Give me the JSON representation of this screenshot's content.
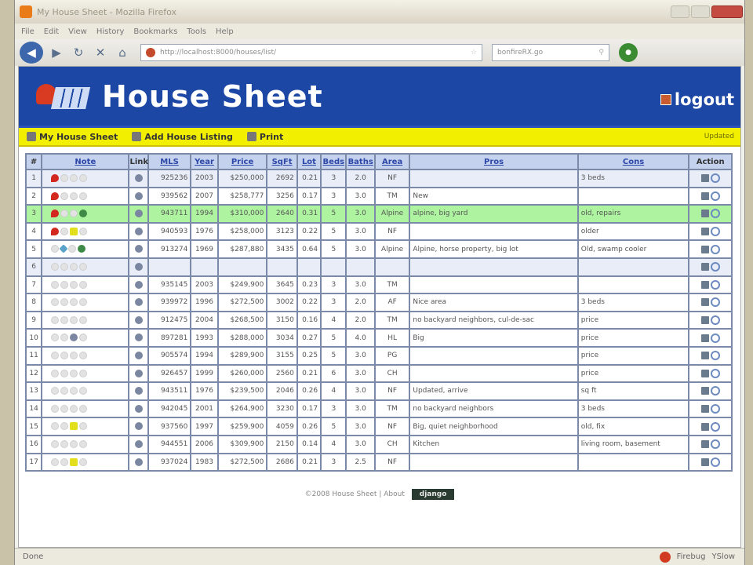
{
  "window": {
    "title": "My House Sheet - Mozilla Firefox"
  },
  "menu": [
    "File",
    "Edit",
    "View",
    "History",
    "Bookmarks",
    "Tools",
    "Help"
  ],
  "nav": {
    "url": "http://localhost:8000/houses/list/",
    "search": "bonfireRX.go"
  },
  "site": {
    "title": "House Sheet",
    "logout": "logout"
  },
  "toolbar": {
    "my_sheet": "My House Sheet",
    "add_listing": "Add House Listing",
    "print": "Print",
    "right": "Updated"
  },
  "table": {
    "headers": [
      "#",
      "Note",
      "Link",
      "MLS",
      "Year",
      "Price",
      "SqFt",
      "Lot",
      "Beds",
      "Baths",
      "Area",
      "Pros",
      "Cons",
      "Action"
    ],
    "rows": [
      {
        "n": "1",
        "icons": [
          "heart",
          "faint",
          "faint",
          "faint"
        ],
        "mls": "925236",
        "year": "2003",
        "price": "$250,000",
        "sqft": "2692",
        "lot": "0.21",
        "beds": "3",
        "baths": "2.0",
        "area": "NF",
        "pros": "",
        "cons": "3 beds",
        "style": "alt"
      },
      {
        "n": "2",
        "icons": [
          "heart",
          "faint",
          "faint",
          "faint"
        ],
        "mls": "939562",
        "year": "2007",
        "price": "$258,777",
        "sqft": "3256",
        "lot": "0.17",
        "beds": "3",
        "baths": "3.0",
        "area": "TM",
        "pros": "New",
        "cons": "",
        "style": ""
      },
      {
        "n": "3",
        "icons": [
          "heart",
          "faint",
          "faint",
          "world"
        ],
        "mls": "943711",
        "year": "1994",
        "price": "$310,000",
        "sqft": "2640",
        "lot": "0.31",
        "beds": "5",
        "baths": "3.0",
        "area": "Alpine",
        "pros": "alpine, big yard",
        "cons": "old, repairs",
        "style": "hl"
      },
      {
        "n": "4",
        "icons": [
          "heart",
          "faint",
          "note",
          "faint"
        ],
        "mls": "940593",
        "year": "1976",
        "price": "$258,000",
        "sqft": "3123",
        "lot": "0.22",
        "beds": "5",
        "baths": "3.0",
        "area": "NF",
        "pros": "",
        "cons": "older",
        "style": ""
      },
      {
        "n": "5",
        "icons": [
          "faint",
          "star",
          "faint",
          "world"
        ],
        "mls": "913274",
        "year": "1969",
        "price": "$287,880",
        "sqft": "3435",
        "lot": "0.64",
        "beds": "5",
        "baths": "3.0",
        "area": "Alpine",
        "pros": "Alpine, horse property, big lot",
        "cons": "Old, swamp cooler",
        "style": ""
      },
      {
        "n": "6",
        "icons": [
          "faint",
          "faint",
          "faint",
          "faint"
        ],
        "mls": "",
        "year": "",
        "price": "",
        "sqft": "",
        "lot": "",
        "beds": "",
        "baths": "",
        "area": "",
        "pros": "",
        "cons": "",
        "style": "alt"
      },
      {
        "n": "7",
        "icons": [
          "faint",
          "faint",
          "faint",
          "faint"
        ],
        "mls": "935145",
        "year": "2003",
        "price": "$249,900",
        "sqft": "3645",
        "lot": "0.23",
        "beds": "3",
        "baths": "3.0",
        "area": "TM",
        "pros": "",
        "cons": "",
        "style": ""
      },
      {
        "n": "8",
        "icons": [
          "faint",
          "faint",
          "faint",
          "faint"
        ],
        "mls": "939972",
        "year": "1996",
        "price": "$272,500",
        "sqft": "3002",
        "lot": "0.22",
        "beds": "3",
        "baths": "2.0",
        "area": "AF",
        "pros": "Nice area",
        "cons": "3 beds",
        "style": ""
      },
      {
        "n": "9",
        "icons": [
          "faint",
          "faint",
          "faint",
          "faint"
        ],
        "mls": "912475",
        "year": "2004",
        "price": "$268,500",
        "sqft": "3150",
        "lot": "0.16",
        "beds": "4",
        "baths": "2.0",
        "area": "TM",
        "pros": "no backyard neighbors, cul-de-sac",
        "cons": "price",
        "style": ""
      },
      {
        "n": "10",
        "icons": [
          "faint",
          "faint",
          "link",
          "faint"
        ],
        "mls": "897281",
        "year": "1993",
        "price": "$288,000",
        "sqft": "3034",
        "lot": "0.27",
        "beds": "5",
        "baths": "4.0",
        "area": "HL",
        "pros": "Big",
        "cons": "price",
        "style": ""
      },
      {
        "n": "11",
        "icons": [
          "faint",
          "faint",
          "faint",
          "faint"
        ],
        "mls": "905574",
        "year": "1994",
        "price": "$289,900",
        "sqft": "3155",
        "lot": "0.25",
        "beds": "5",
        "baths": "3.0",
        "area": "PG",
        "pros": "",
        "cons": "price",
        "style": ""
      },
      {
        "n": "12",
        "icons": [
          "faint",
          "faint",
          "faint",
          "faint"
        ],
        "mls": "926457",
        "year": "1999",
        "price": "$260,000",
        "sqft": "2560",
        "lot": "0.21",
        "beds": "6",
        "baths": "3.0",
        "area": "CH",
        "pros": "",
        "cons": "price",
        "style": ""
      },
      {
        "n": "13",
        "icons": [
          "faint",
          "faint",
          "faint",
          "faint"
        ],
        "mls": "943511",
        "year": "1976",
        "price": "$239,500",
        "sqft": "2046",
        "lot": "0.26",
        "beds": "4",
        "baths": "3.0",
        "area": "NF",
        "pros": "Updated, arrive",
        "cons": "sq ft",
        "style": ""
      },
      {
        "n": "14",
        "icons": [
          "faint",
          "faint",
          "faint",
          "faint"
        ],
        "mls": "942045",
        "year": "2001",
        "price": "$264,900",
        "sqft": "3230",
        "lot": "0.17",
        "beds": "3",
        "baths": "3.0",
        "area": "TM",
        "pros": "no backyard neighbors",
        "cons": "3 beds",
        "style": ""
      },
      {
        "n": "15",
        "icons": [
          "faint",
          "faint",
          "note",
          "faint"
        ],
        "mls": "937560",
        "year": "1997",
        "price": "$259,900",
        "sqft": "4059",
        "lot": "0.26",
        "beds": "5",
        "baths": "3.0",
        "area": "NF",
        "pros": "Big, quiet neighborhood",
        "cons": "old, fix",
        "style": ""
      },
      {
        "n": "16",
        "icons": [
          "faint",
          "faint",
          "faint",
          "faint"
        ],
        "mls": "944551",
        "year": "2006",
        "price": "$309,900",
        "sqft": "2150",
        "lot": "0.14",
        "beds": "4",
        "baths": "3.0",
        "area": "CH",
        "pros": "Kitchen",
        "cons": "living room, basement",
        "style": ""
      },
      {
        "n": "17",
        "icons": [
          "faint",
          "faint",
          "note",
          "faint"
        ],
        "mls": "937024",
        "year": "1983",
        "price": "$272,500",
        "sqft": "2686",
        "lot": "0.21",
        "beds": "3",
        "baths": "2.5",
        "area": "NF",
        "pros": "",
        "cons": "",
        "style": ""
      }
    ]
  },
  "footer": {
    "copyright": "©2008 House Sheet",
    "sep": "|",
    "about": "About",
    "powered": "django"
  },
  "status": {
    "text": "Done",
    "firebug": "Firebug",
    "yslow": "YSlow"
  }
}
